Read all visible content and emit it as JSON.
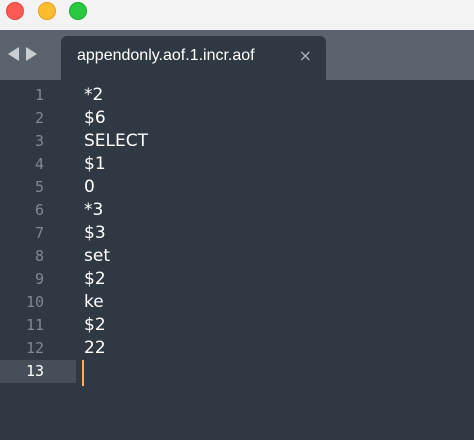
{
  "tab": {
    "title": "appendonly.aof.1.incr.aof",
    "close_icon": "×"
  },
  "nav": {
    "back_icon": "chevron-left-icon",
    "forward_icon": "chevron-right-icon"
  },
  "window_controls": [
    "close",
    "minimize",
    "zoom"
  ],
  "colors": {
    "editor_bg": "#2f3943",
    "tabbar_bg": "#5a646e",
    "cursor": "#f9ae58",
    "gutter_text": "#7f8a94"
  },
  "editor": {
    "lines": [
      {
        "num": "1",
        "text": "*2"
      },
      {
        "num": "2",
        "text": "$6"
      },
      {
        "num": "3",
        "text": "SELECT"
      },
      {
        "num": "4",
        "text": "$1"
      },
      {
        "num": "5",
        "text": "0"
      },
      {
        "num": "6",
        "text": "*3"
      },
      {
        "num": "7",
        "text": "$3"
      },
      {
        "num": "8",
        "text": "set"
      },
      {
        "num": "9",
        "text": "$2"
      },
      {
        "num": "10",
        "text": "ke"
      },
      {
        "num": "11",
        "text": "$2"
      },
      {
        "num": "12",
        "text": "22"
      },
      {
        "num": "13",
        "text": ""
      }
    ],
    "active_line": 13
  }
}
